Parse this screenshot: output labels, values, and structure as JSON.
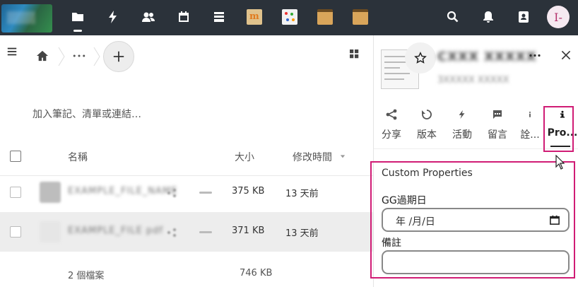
{
  "topbar": {
    "apps": [
      "files-icon",
      "activity-icon",
      "contacts-icon",
      "calendar-icon",
      "deck-icon",
      "moodle-icon",
      "colors-icon",
      "table-icon-1",
      "table-icon-2"
    ],
    "avatar_letter": "I-",
    "accent": "#2b323a",
    "highlight": "#d01c75"
  },
  "main": {
    "description_placeholder": "加入筆記、清單或連結…",
    "columns": {
      "name": "名稱",
      "size": "大小",
      "modified": "修改時間"
    },
    "files": [
      {
        "size": "375 KB",
        "modified": "13 天前"
      },
      {
        "size": "371 KB",
        "modified": "13 天前"
      }
    ],
    "footer": {
      "count": "2 個檔案",
      "total": "746 KB"
    }
  },
  "sidebar": {
    "tabs": [
      {
        "label": "分享",
        "icon": "share-icon"
      },
      {
        "label": "版本",
        "icon": "history-icon"
      },
      {
        "label": "活動",
        "icon": "activity-icon"
      },
      {
        "label": "留言",
        "icon": "comment-icon"
      },
      {
        "label": "詮...",
        "icon": "info-icon"
      },
      {
        "label": "Pro...",
        "icon": "info-bold-icon"
      }
    ],
    "properties": {
      "title": "Custom Properties",
      "date_label": "GG過期日",
      "date_value": "年 /月/日",
      "note_label": "備註"
    }
  }
}
